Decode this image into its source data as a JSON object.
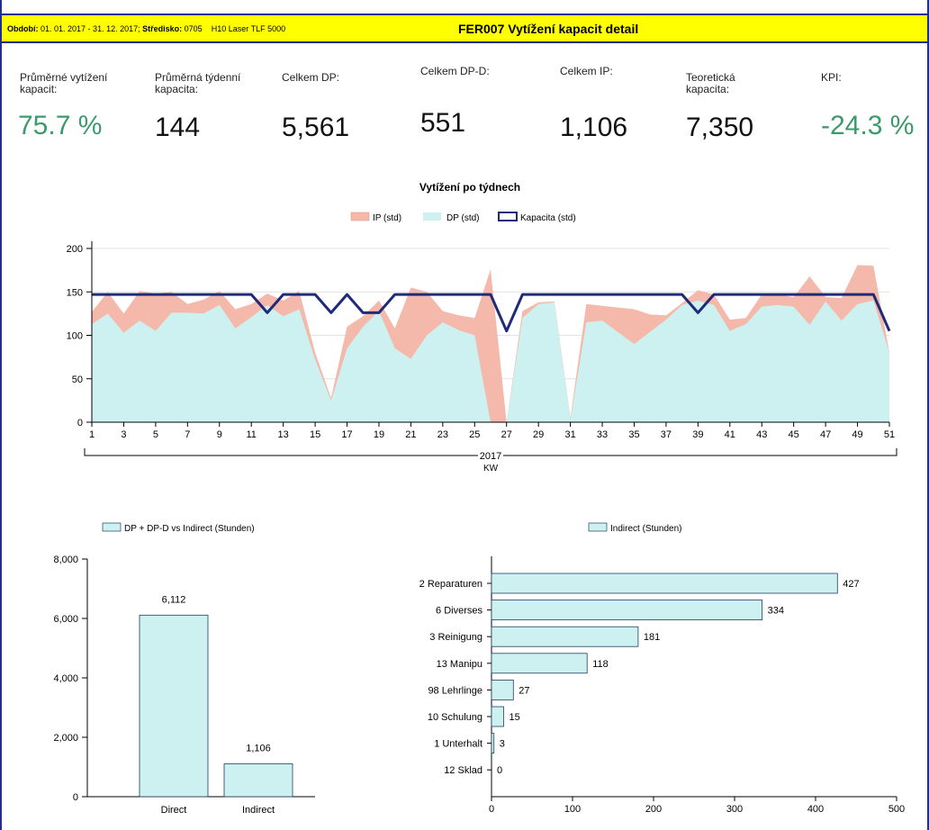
{
  "header": {
    "filter_label_period": "Období:",
    "filter_value_period": "01. 01. 2017 - 31. 12. 2017;",
    "filter_label_center": "Středisko:",
    "filter_value_center": "0705",
    "filter_machine": "H10 Laser TLF 5000",
    "title": "FER007 Vytížení kapacit detail"
  },
  "kpis": [
    {
      "label": "Průměrné vytížení kapacit:",
      "value": "75.7 %",
      "highlight": true
    },
    {
      "label": "Průměrná týdenní kapacita:",
      "value": "144",
      "highlight": false
    },
    {
      "label": "Celkem DP:",
      "value": "5,561",
      "highlight": false
    },
    {
      "label": "Celkem DP-D:",
      "value": "551",
      "highlight": false
    },
    {
      "label": "Celkem IP:",
      "value": "1,106",
      "highlight": false
    },
    {
      "label": "Teoretická kapacita:",
      "value": "7,350",
      "highlight": false
    },
    {
      "label": "KPI:",
      "value": "-24.3 %",
      "highlight": true
    }
  ],
  "colors": {
    "header_bg": "#ffff00",
    "frame": "#1f2f8a",
    "kpi_green": "#3c9a6b",
    "ip_fill": "#f4b9aa",
    "dp_fill": "#cdf0f0",
    "capacity_line": "#1f2a78",
    "bar_fill": "#cdf0f0",
    "bar_stroke": "#1f3f5f"
  },
  "chart_data": [
    {
      "type": "area",
      "title": "Vytížení po týdnech",
      "xlabel": "KW",
      "group_label": "2017",
      "ylim": [
        0,
        200
      ],
      "yticks": [
        0,
        50,
        100,
        150,
        200
      ],
      "xticks": [
        1,
        3,
        5,
        7,
        9,
        11,
        13,
        15,
        17,
        19,
        21,
        23,
        25,
        27,
        29,
        31,
        33,
        35,
        37,
        39,
        41,
        43,
        45,
        47,
        49,
        51
      ],
      "x": [
        1,
        2,
        3,
        4,
        5,
        6,
        7,
        8,
        9,
        10,
        11,
        12,
        13,
        14,
        15,
        16,
        17,
        18,
        19,
        20,
        21,
        22,
        23,
        24,
        25,
        26,
        27,
        28,
        29,
        30,
        31,
        32,
        33,
        35,
        36,
        37,
        38,
        39,
        40,
        41,
        42,
        43,
        44,
        45,
        46,
        47,
        48,
        49,
        50,
        51
      ],
      "series": [
        {
          "name": "IP (std)",
          "kind": "area-stacked-total",
          "values": [
            127,
            150,
            125,
            151,
            148,
            150,
            136,
            141,
            151,
            130,
            136,
            148,
            140,
            151,
            80,
            28,
            110,
            122,
            140,
            108,
            155,
            150,
            128,
            123,
            120,
            176,
            0,
            128,
            138,
            139,
            5,
            136,
            134,
            130,
            124,
            123,
            137,
            152,
            147,
            118,
            120,
            147,
            147,
            144,
            168,
            144,
            143,
            181,
            180,
            80
          ]
        },
        {
          "name": "DP (std)",
          "kind": "area",
          "values": [
            113,
            125,
            103,
            117,
            105,
            126,
            126,
            125,
            135,
            108,
            121,
            135,
            122,
            130,
            72,
            25,
            85,
            110,
            128,
            85,
            73,
            100,
            115,
            106,
            100,
            0,
            0,
            120,
            136,
            138,
            3,
            115,
            117,
            90,
            104,
            118,
            135,
            140,
            135,
            105,
            113,
            133,
            135,
            133,
            112,
            139,
            117,
            136,
            140,
            80
          ]
        },
        {
          "name": "Kapacita (std)",
          "kind": "line",
          "values": [
            147,
            147,
            147,
            147,
            147,
            147,
            147,
            147,
            147,
            147,
            147,
            126,
            147,
            147,
            147,
            126,
            147,
            126,
            126,
            147,
            147,
            147,
            147,
            147,
            147,
            147,
            105,
            147,
            147,
            147,
            147,
            147,
            147,
            147,
            147,
            147,
            147,
            126,
            147,
            147,
            147,
            147,
            147,
            147,
            147,
            147,
            147,
            147,
            147,
            105
          ]
        }
      ]
    },
    {
      "type": "bar",
      "legend": "DP + DP-D vs Indirect (Stunden)",
      "categories": [
        "Direct",
        "Indirect"
      ],
      "values": [
        6112,
        1106
      ],
      "value_labels": [
        "6,112",
        "1,106"
      ],
      "ylim": [
        0,
        8000
      ],
      "yticks": [
        0,
        2000,
        4000,
        6000,
        8000
      ],
      "ytick_labels": [
        "0",
        "2,000",
        "4,000",
        "6,000",
        "8,000"
      ]
    },
    {
      "type": "bar",
      "orientation": "horizontal",
      "legend": "Indirect (Stunden)",
      "categories": [
        "2 Reparaturen",
        "6 Diverses",
        "3 Reinigung",
        "13 Manipu",
        "98 Lehrlinge",
        "10 Schulung",
        "1 Unterhalt",
        "12 Sklad"
      ],
      "values": [
        427,
        334,
        181,
        118,
        27,
        15,
        3,
        0
      ],
      "xlim": [
        0,
        500
      ],
      "xticks": [
        0,
        100,
        200,
        300,
        400,
        500
      ]
    }
  ]
}
